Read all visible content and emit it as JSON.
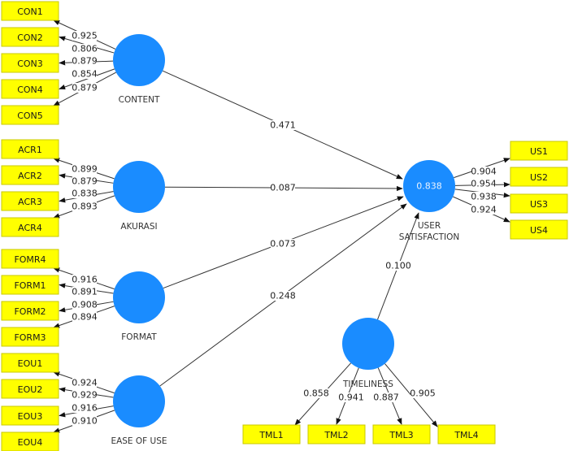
{
  "diagram": {
    "type": "PLS-SEM path model",
    "colors": {
      "latent_fill": "#1a8cff",
      "indicator_fill": "#ffff00",
      "edge": "#333333"
    },
    "latent_variables": [
      {
        "id": "content",
        "label": "CONTENT",
        "r_squared": null
      },
      {
        "id": "akurasi",
        "label": "AKURASI",
        "r_squared": null
      },
      {
        "id": "format",
        "label": "FORMAT",
        "r_squared": null
      },
      {
        "id": "ease",
        "label": "EASE OF USE",
        "r_squared": null
      },
      {
        "id": "us",
        "label": "USER SATISFACTION",
        "label_lines": [
          "USER",
          "SATISFACTION"
        ],
        "r_squared": "0.838"
      },
      {
        "id": "timeliness",
        "label": "TIMELINESS",
        "r_squared": null
      }
    ],
    "indicators": [
      {
        "id": "CON1",
        "label": "CON1",
        "latent": "content",
        "loading": "0.925"
      },
      {
        "id": "CON2",
        "label": "CON2",
        "latent": "content",
        "loading": "0.806"
      },
      {
        "id": "CON3",
        "label": "CON3",
        "latent": "content",
        "loading": "0.879"
      },
      {
        "id": "CON4",
        "label": "CON4",
        "latent": "content",
        "loading": "0.854"
      },
      {
        "id": "CON5",
        "label": "CON5",
        "latent": "content",
        "loading": "0.879"
      },
      {
        "id": "ACR1",
        "label": "ACR1",
        "latent": "akurasi",
        "loading": "0.899"
      },
      {
        "id": "ACR2",
        "label": "ACR2",
        "latent": "akurasi",
        "loading": "0.879"
      },
      {
        "id": "ACR3",
        "label": "ACR3",
        "latent": "akurasi",
        "loading": "0.838"
      },
      {
        "id": "ACR4",
        "label": "ACR4",
        "latent": "akurasi",
        "loading": "0.893"
      },
      {
        "id": "FOMR4",
        "label": "FOMR4",
        "latent": "format",
        "loading": "0.916"
      },
      {
        "id": "FORM1",
        "label": "FORM1",
        "latent": "format",
        "loading": "0.891"
      },
      {
        "id": "FORM2",
        "label": "FORM2",
        "latent": "format",
        "loading": "0.908"
      },
      {
        "id": "FORM3",
        "label": "FORM3",
        "latent": "format",
        "loading": "0.894"
      },
      {
        "id": "EOU1",
        "label": "EOU1",
        "latent": "ease",
        "loading": "0.924"
      },
      {
        "id": "EOU2",
        "label": "EOU2",
        "latent": "ease",
        "loading": "0.929"
      },
      {
        "id": "EOU3",
        "label": "EOU3",
        "latent": "ease",
        "loading": "0.916"
      },
      {
        "id": "EOU4",
        "label": "EOU4",
        "latent": "ease",
        "loading": "0.910"
      },
      {
        "id": "US1",
        "label": "US1",
        "latent": "us",
        "loading": "0.904"
      },
      {
        "id": "US2",
        "label": "US2",
        "latent": "us",
        "loading": "0.954"
      },
      {
        "id": "US3",
        "label": "US3",
        "latent": "us",
        "loading": "0.938"
      },
      {
        "id": "US4",
        "label": "US4",
        "latent": "us",
        "loading": "0.924"
      },
      {
        "id": "TML1",
        "label": "TML1",
        "latent": "timeliness",
        "loading": "0.858"
      },
      {
        "id": "TML2",
        "label": "TML2",
        "latent": "timeliness",
        "loading": "0.941"
      },
      {
        "id": "TML3",
        "label": "TML3",
        "latent": "timeliness",
        "loading": "0.887"
      },
      {
        "id": "TML4",
        "label": "TML4",
        "latent": "timeliness",
        "loading": "0.905"
      }
    ],
    "paths": [
      {
        "from": "content",
        "to": "us",
        "coefficient": "0.471"
      },
      {
        "from": "akurasi",
        "to": "us",
        "coefficient": "0.087"
      },
      {
        "from": "format",
        "to": "us",
        "coefficient": "0.073"
      },
      {
        "from": "ease",
        "to": "us",
        "coefficient": "0.248"
      },
      {
        "from": "timeliness",
        "to": "us",
        "coefficient": "0.100"
      }
    ]
  }
}
